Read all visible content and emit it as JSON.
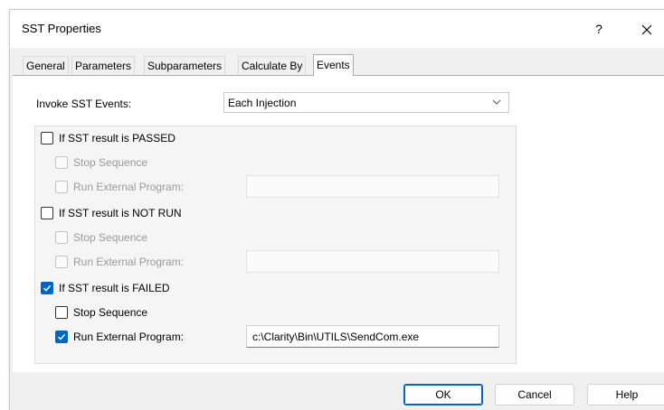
{
  "window": {
    "title": "SST Properties",
    "help_label": "?"
  },
  "tabs": [
    {
      "label": "General",
      "active": false
    },
    {
      "label": "Parameters",
      "active": false
    },
    {
      "label": "Subparameters",
      "active": false
    },
    {
      "label": "Calculate By",
      "active": false
    },
    {
      "label": "Events",
      "active": true
    }
  ],
  "invoke": {
    "label": "Invoke SST Events:",
    "value": "Each Injection"
  },
  "sections": [
    {
      "label": "If SST result is PASSED",
      "checked": false,
      "stop_label": "Stop Sequence",
      "stop_checked": false,
      "run_label": "Run External Program:",
      "run_checked": false,
      "path": "",
      "enabled": false
    },
    {
      "label": "If SST result is NOT RUN",
      "checked": false,
      "stop_label": "Stop Sequence",
      "stop_checked": false,
      "run_label": "Run External Program:",
      "run_checked": false,
      "path": "",
      "enabled": false
    },
    {
      "label": "If SST result is FAILED",
      "checked": true,
      "stop_label": "Stop Sequence",
      "stop_checked": false,
      "run_label": "Run External Program:",
      "run_checked": true,
      "path": "c:\\Clarity\\Bin\\UTILS\\SendCom.exe",
      "enabled": true
    }
  ],
  "buttons": {
    "ok": "OK",
    "cancel": "Cancel",
    "help": "Help"
  },
  "colors": {
    "accent": "#0067c0",
    "disabled_text": "#9a9a9a"
  }
}
